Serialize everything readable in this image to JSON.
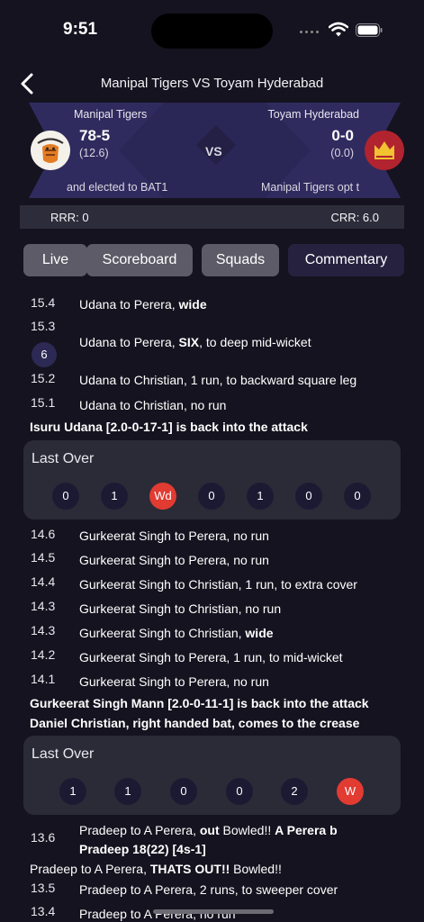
{
  "status_bar": {
    "time": "9:51"
  },
  "header": {
    "title": "Manipal Tigers VS Toyam Hyderabad"
  },
  "match": {
    "team_left": {
      "name": "Manipal Tigers",
      "score": "78-5",
      "overs": "(12.6)",
      "note": "and elected to BAT1"
    },
    "vs": "VS",
    "team_right": {
      "name": "Toyam Hyderabad",
      "score": "0-0",
      "overs": "(0.0)",
      "note": "Manipal Tigers opt t"
    },
    "rrr": "RRR: 0",
    "crr": "CRR: 6.0"
  },
  "tabs": [
    "Live",
    "Scoreboard",
    "Squads",
    "Commentary"
  ],
  "active_tab": "Commentary",
  "commentary_a": {
    "b1": {
      "num": "15.4",
      "pre": "Udana to Perera, ",
      "bold": "wide",
      "post": ""
    },
    "b2": {
      "num": "15.3",
      "badge": "6",
      "pre": "Udana to Perera, ",
      "bold": "SIX",
      "post": ", to deep mid-wicket"
    },
    "b3": {
      "num": "15.2",
      "text": "Udana to Christian, 1 run, to backward square leg"
    },
    "b4": {
      "num": "15.1",
      "text": "Udana to Christian, no run"
    },
    "note": "Isuru Udana [2.0-0-17-1] is back into the attack"
  },
  "last_over_1": {
    "title": "Last Over",
    "balls": [
      "0",
      "1",
      "Wd",
      "0",
      "1",
      "0",
      "0"
    ]
  },
  "commentary_b": {
    "b1": {
      "num": "14.6",
      "text": "Gurkeerat Singh to Perera, no run"
    },
    "b2": {
      "num": "14.5",
      "text": "Gurkeerat Singh to Perera, no run"
    },
    "b3": {
      "num": "14.4",
      "text": "Gurkeerat Singh to Christian, 1 run, to extra cover"
    },
    "b4": {
      "num": "14.3",
      "text": "Gurkeerat Singh to Christian, no run"
    },
    "b5": {
      "num": "14.3",
      "pre": "Gurkeerat Singh to Christian, ",
      "bold": "wide"
    },
    "b6": {
      "num": "14.2",
      "text": "Gurkeerat Singh to Perera, 1 run, to mid-wicket"
    },
    "b7": {
      "num": "14.1",
      "text": "Gurkeerat Singh to Perera, no run"
    },
    "note1": "Gurkeerat Singh Mann [2.0-0-11-1] is back into the attack",
    "note2": "Daniel Christian, right handed bat, comes to the crease"
  },
  "last_over_2": {
    "title": "Last Over",
    "balls": [
      "1",
      "1",
      "0",
      "0",
      "2",
      "W"
    ]
  },
  "commentary_c": {
    "b1": {
      "num": "13.6",
      "pre": "Pradeep to A Perera, ",
      "bold1": "out",
      "mid": " Bowled!! ",
      "bold2": "A Perera b",
      "line2": "Pradeep 18(22) [4s-1]"
    },
    "out_pre": "Pradeep to A Perera, ",
    "out_bold": "THATS OUT!!",
    "out_post": " Bowled!!",
    "b2": {
      "num": "13.5",
      "text": "Pradeep to A Perera, 2 runs, to sweeper cover"
    },
    "b3": {
      "num": "13.4",
      "text": "Pradeep to A Perera, no run"
    }
  },
  "colors": {
    "background": "#15131f",
    "accent_red": "#e13b32",
    "active_tab": "#25213f",
    "tab": "#5c5b67",
    "card": "#2b2a37"
  }
}
